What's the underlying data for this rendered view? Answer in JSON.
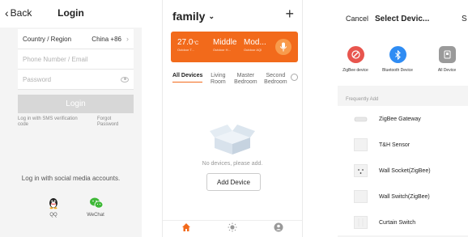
{
  "login": {
    "back_label": "Back",
    "title": "Login",
    "country_label": "Country / Region",
    "country_value": "China +86",
    "phone_placeholder": "Phone Number / Email",
    "password_placeholder": "Password",
    "login_button": "Login",
    "sms_link": "Log in with SMS verification code",
    "forgot_link": "Forgot Password",
    "social_heading": "Log in with social media accounts.",
    "social": [
      {
        "label": "QQ",
        "icon": "qq-penguin-icon"
      },
      {
        "label": "WeChat",
        "icon": "wechat-icon"
      }
    ]
  },
  "home": {
    "family_label": "family",
    "weather": [
      {
        "value": "27.0",
        "unit": "°C",
        "caption": "Outdoor T..."
      },
      {
        "value": "Middle",
        "caption": "Outdoor H..."
      },
      {
        "value": "Mod...",
        "caption": "Outdoor AQI"
      }
    ],
    "tabs": [
      {
        "label": "All Devices",
        "active": true
      },
      {
        "label": "Living Room"
      },
      {
        "label": "Master Bedroom"
      },
      {
        "label": "Second Bedroom"
      }
    ],
    "empty_text": "No devices, please add.",
    "add_device_button": "Add Device",
    "accent_color": "#f26a1b"
  },
  "select_device": {
    "cancel_label": "Cancel",
    "title": "Select Devic...",
    "title_overflow": "S",
    "categories": [
      {
        "label": "ZigBee device",
        "color": "#e8554e"
      },
      {
        "label": "Bluetooth Device",
        "color": "#2f8cf3"
      },
      {
        "label": "All Device",
        "color": "#9a9a9a"
      }
    ],
    "frequently_label": "Frequently Add",
    "devices": [
      {
        "label": "ZigBee Gateway"
      },
      {
        "label": "T&H Sensor"
      },
      {
        "label": "Wall Socket(ZigBee)"
      },
      {
        "label": "Wall Switch(ZigBee)"
      },
      {
        "label": "Curtain Switch"
      }
    ]
  }
}
